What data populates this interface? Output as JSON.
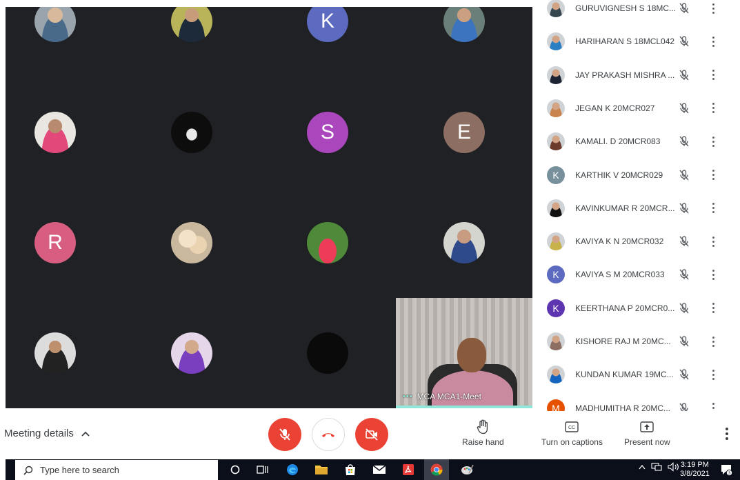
{
  "grid": {
    "tiles": [
      {
        "kind": "photo",
        "style": "p1",
        "letter": ""
      },
      {
        "kind": "photo",
        "style": "p2",
        "letter": ""
      },
      {
        "kind": "letter",
        "style": "",
        "letter": "K",
        "color": "#5c6bc0"
      },
      {
        "kind": "photo",
        "style": "p3",
        "letter": ""
      },
      {
        "kind": "photo",
        "style": "p4",
        "letter": ""
      },
      {
        "kind": "photo",
        "style": "dark",
        "letter": ""
      },
      {
        "kind": "letter",
        "style": "",
        "letter": "S",
        "color": "#ab47bc"
      },
      {
        "kind": "letter",
        "style": "",
        "letter": "E",
        "color": "#8d6e63"
      },
      {
        "kind": "letter",
        "style": "",
        "letter": "R",
        "color": "#d75e80"
      },
      {
        "kind": "photo",
        "style": "p6",
        "letter": ""
      },
      {
        "kind": "photo",
        "style": "p7",
        "letter": ""
      },
      {
        "kind": "photo",
        "style": "p8",
        "letter": ""
      },
      {
        "kind": "photo",
        "style": "p9",
        "letter": ""
      },
      {
        "kind": "photo",
        "style": "p10",
        "letter": ""
      },
      {
        "kind": "logo",
        "style": "black-logo",
        "letter": ""
      }
    ]
  },
  "presenter": {
    "name": "MCA MCA1-Meet",
    "dots": "•••"
  },
  "participants": [
    {
      "name": "GURUVIGNESH S 18MC...",
      "avatar": "photo",
      "letter": "",
      "color": "#37474f"
    },
    {
      "name": "HARIHARAN S 18MCL042",
      "avatar": "photo",
      "letter": "",
      "color": "#2a7fc4"
    },
    {
      "name": "JAY PRAKASH MISHRA ...",
      "avatar": "photo",
      "letter": "",
      "color": "#1c2433"
    },
    {
      "name": "JEGAN K 20MCR027",
      "avatar": "photo",
      "letter": "",
      "color": "#c9834f"
    },
    {
      "name": "KAMALI. D 20MCR083",
      "avatar": "photo",
      "letter": "",
      "color": "#6b3a2a"
    },
    {
      "name": "KARTHIK V 20MCR029",
      "avatar": "letter",
      "letter": "K",
      "color": "#78909c"
    },
    {
      "name": "KAVINKUMAR R 20MCR...",
      "avatar": "photo",
      "letter": "",
      "color": "#111111"
    },
    {
      "name": "KAVIYA K N 20MCR032",
      "avatar": "photo",
      "letter": "",
      "color": "#c8b24a"
    },
    {
      "name": "KAVIYA S M 20MCR033",
      "avatar": "letter",
      "letter": "K",
      "color": "#5c6bc0"
    },
    {
      "name": "KEERTHANA P 20MCR0...",
      "avatar": "letter",
      "letter": "K",
      "color": "#5e35b1"
    },
    {
      "name": "KISHORE RAJ M 20MC...",
      "avatar": "photo",
      "letter": "",
      "color": "#8d6e63"
    },
    {
      "name": "KUNDAN KUMAR 19MC...",
      "avatar": "photo",
      "letter": "",
      "color": "#1565c0"
    },
    {
      "name": "MADHUMITHA R 20MC...",
      "avatar": "letter",
      "letter": "M",
      "color": "#e65100"
    }
  ],
  "bottombar": {
    "meeting_details": "Meeting details",
    "raise_hand": "Raise hand",
    "captions": "Turn on captions",
    "present": "Present now"
  },
  "taskbar": {
    "search_placeholder": "Type here to search",
    "time": "3:19 PM",
    "date": "3/8/2021",
    "notification_count": "3"
  },
  "colors": {
    "red": "#ea4335",
    "grid_bg": "#202124",
    "accent": "#8ee7d9"
  }
}
